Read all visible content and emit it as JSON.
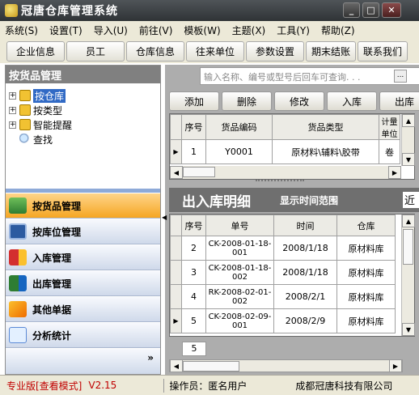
{
  "window": {
    "title": "冠唐仓库管理系统"
  },
  "menu": [
    "系统(S)",
    "设置(T)",
    "导入(U)",
    "前往(V)",
    "模板(W)",
    "主题(X)",
    "工具(Y)",
    "帮助(Z)"
  ],
  "toolbar": [
    "企业信息",
    "员工",
    "仓库信息",
    "往来单位",
    "参数设置",
    "期末结账",
    "联系我们"
  ],
  "left": {
    "header": "按货品管理",
    "tree": [
      "按仓库",
      "按类型",
      "智能提醒",
      "查找"
    ],
    "nav": [
      "按货品管理",
      "按库位管理",
      "入库管理",
      "出库管理",
      "其他单据",
      "分析统计"
    ],
    "more": "»"
  },
  "search": {
    "placeholder": "输入名称、编号或型号后回车可查询. . .",
    "button": "..."
  },
  "actions": [
    "添加",
    "删除",
    "修改",
    "入库",
    "出库"
  ],
  "goods": {
    "headers": [
      "序号",
      "货品编码",
      "货品类型",
      "计量单位"
    ],
    "rows": [
      {
        "no": "1",
        "code": "Y0001",
        "type": "原材料\\辅料\\胶带",
        "unit": "卷"
      }
    ]
  },
  "flow": {
    "title": "出入库明细",
    "range_label": "显示时间范围",
    "range_value": "近",
    "headers": [
      "序号",
      "单号",
      "时间",
      "仓库"
    ],
    "rows": [
      {
        "no": "2",
        "id": "CK-2008-01-18-001",
        "date": "2008/1/18",
        "wh": "原材料库"
      },
      {
        "no": "3",
        "id": "CK-2008-01-18-002",
        "date": "2008/1/18",
        "wh": "原材料库"
      },
      {
        "no": "4",
        "id": "RK-2008-02-01-002",
        "date": "2008/2/1",
        "wh": "原材料库"
      },
      {
        "no": "5",
        "id": "CK-2008-02-09-001",
        "date": "2008/2/9",
        "wh": "原材料库"
      }
    ],
    "count": "5"
  },
  "status": {
    "edition": "专业版[查看模式]",
    "version": "V2.15",
    "operator": "操作员：匿名用户",
    "company": "成都冠唐科技有限公司"
  }
}
